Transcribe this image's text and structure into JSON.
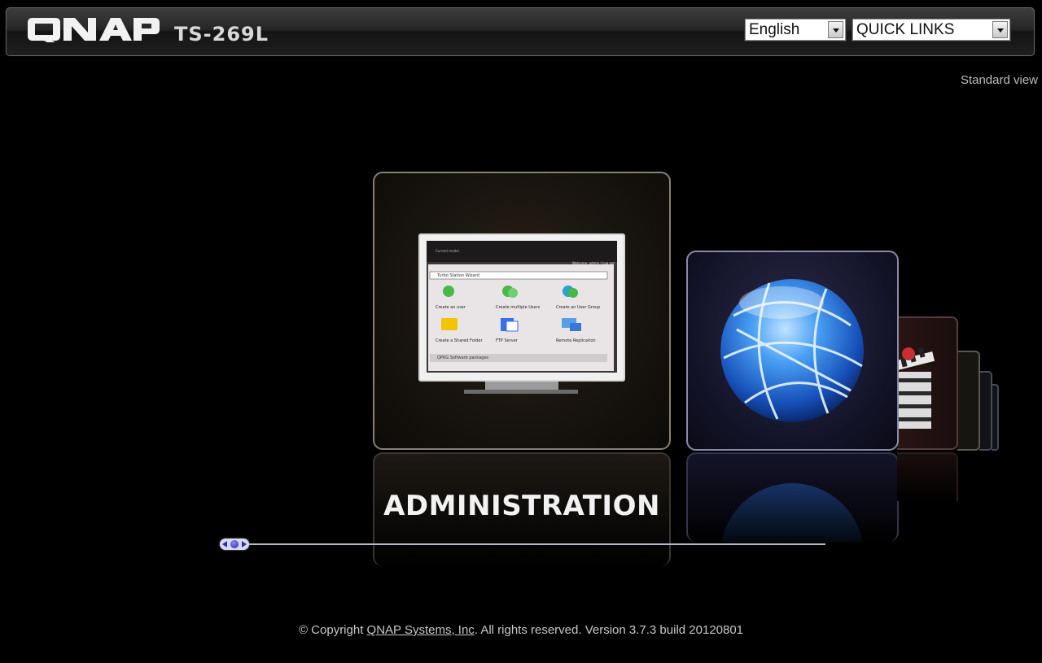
{
  "header": {
    "brand": "QNAP",
    "model": "TS-269L",
    "language_select": {
      "value": "English"
    },
    "quick_links_select": {
      "value": "QUICK LINKS"
    }
  },
  "standard_view_label": "Standard view",
  "carousel": {
    "active_title": "ADMINISTRATION",
    "monitor_screen": {
      "tab_label": "Current model",
      "top_right": "Welcome, admin | Log out",
      "wizard_title": "Turbo Station Wizard",
      "items": [
        {
          "label": "Create an user",
          "icon": "user-icon"
        },
        {
          "label": "Create multiple Users",
          "icon": "users-icon"
        },
        {
          "label": "Create an User Group",
          "icon": "group-icon"
        },
        {
          "label": "Create a Shared Folder",
          "icon": "folder-icon"
        },
        {
          "label": "FTP Server",
          "icon": "ftp-icon"
        },
        {
          "label": "Remote Replication",
          "icon": "replication-icon"
        }
      ],
      "bottom_label": "QPKG Software packages"
    },
    "cards": [
      {
        "name": "administration",
        "icon": "monitor-icon"
      },
      {
        "name": "web-server",
        "icon": "globe-icon"
      },
      {
        "name": "multimedia",
        "icon": "clapperboard-icon"
      }
    ],
    "slider_position": 0
  },
  "footer": {
    "copyright_prefix": "© Copyright ",
    "company_link": "QNAP Systems, Inc",
    "copyright_suffix": ". All rights reserved. Version 3.7.3 build 20120801"
  },
  "colors": {
    "background": "#000000",
    "globe": "#3a8ef0",
    "slider_handle": "#2a2ab8"
  }
}
